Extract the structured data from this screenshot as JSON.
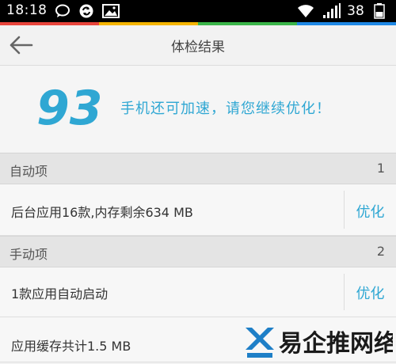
{
  "status_bar": {
    "time": "18:18",
    "battery": "38"
  },
  "header": {
    "title": "体检结果"
  },
  "score": {
    "value": "93",
    "message": "手机还可加速，请您继续优化！"
  },
  "sections": [
    {
      "label": "自动项",
      "count": "1"
    },
    {
      "label": "手动项",
      "count": "2"
    }
  ],
  "rows": [
    {
      "text": "后台应用16款,内存剩余634 MB",
      "action": "优化"
    },
    {
      "text": "1款应用自动启动",
      "action": "优化"
    },
    {
      "text": "应用缓存共计1.5 MB",
      "action": ""
    }
  ],
  "watermark": {
    "text": "易企推网络"
  },
  "colors": {
    "accent_blue": "#2fa7d3",
    "strip": [
      "#e8453c",
      "#f4b400",
      "#3bb54a",
      "#1e88e5"
    ]
  },
  "icons": [
    "chat-bubble-icon",
    "sync-icon",
    "image-icon",
    "wifi-icon",
    "signal-icon",
    "battery-icon",
    "back-arrow-icon"
  ]
}
